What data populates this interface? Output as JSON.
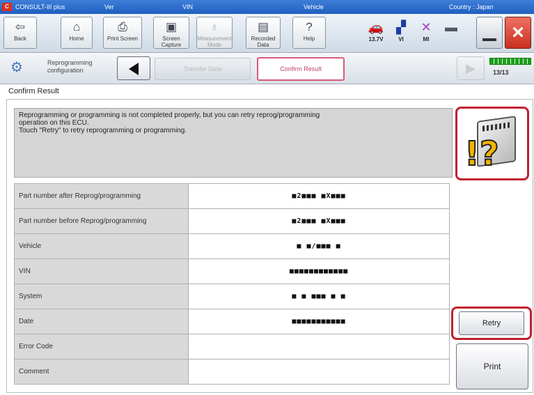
{
  "titlebar": {
    "app_name": "CONSULT-III plus",
    "ver_label": "Ver",
    "vin_label": "VIN",
    "vehicle_label": "Vehicle",
    "country_label": "Country : Japan"
  },
  "toolbar": {
    "back_label": "Back",
    "home_label": "Home",
    "print_screen_label": "Print Screen",
    "screen_capture_label": "Screen Capture",
    "measurement_mode_label": "Measurement Mode",
    "recorded_data_label": "Recorded Data",
    "help_label": "Help",
    "battery_voltage": "13.7V",
    "vi_label": "VI",
    "mi_label": "MI"
  },
  "navbar": {
    "title": "Reprogramming configuration",
    "prev_step": "Transfer Data",
    "current_step": "Confirm Result",
    "page": "13/13"
  },
  "screen_title": "Confirm Result",
  "message": {
    "line1": "Reprogramming or programming is not completed properly, but you can retry reprog/programming",
    "line2": "operation on this ECU.",
    "line3": "Touch \"Retry\" to retry reprogramming or programming."
  },
  "table": {
    "rows": [
      {
        "label": "Part number after Reprog/programming",
        "value": "■2■■■ ■X■■■"
      },
      {
        "label": "Part number before Reprog/programming",
        "value": "■2■■■ ■X■■■"
      },
      {
        "label": "Vehicle",
        "value": "■ ■/■■■ ■"
      },
      {
        "label": "VIN",
        "value": "■■■■■■■■■■■■"
      },
      {
        "label": "System",
        "value": "■ ■ ■■■ ■ ■"
      },
      {
        "label": "Date",
        "value": "■■■■■■■■■■■"
      },
      {
        "label": "Error Code",
        "value": ""
      },
      {
        "label": "Comment",
        "value": ""
      }
    ]
  },
  "buttons": {
    "retry": "Retry",
    "print": "Print"
  },
  "colors": {
    "highlight_red": "#c02030",
    "titlebar_blue": "#2a68c8"
  }
}
